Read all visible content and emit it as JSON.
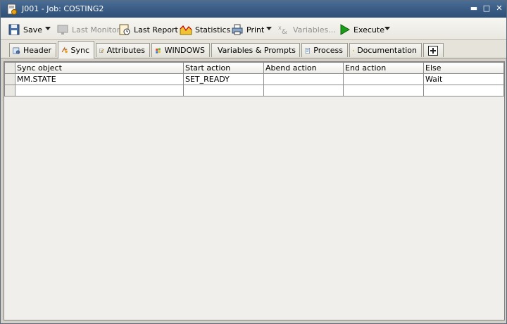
{
  "window": {
    "title": "J001 - Job: COSTING2"
  },
  "toolbar": {
    "save": "Save",
    "last_monitor": "Last Monitor",
    "last_report": "Last Report",
    "statistics": "Statistics",
    "print": "Print",
    "variables": "Variables...",
    "execute": "Execute"
  },
  "tabs": [
    {
      "label": "Header"
    },
    {
      "label": "Sync"
    },
    {
      "label": "Attributes"
    },
    {
      "label": "WINDOWS"
    },
    {
      "label": "Variables & Prompts"
    },
    {
      "label": "Process"
    },
    {
      "label": "Documentation"
    }
  ],
  "active_tab": "Sync",
  "grid": {
    "columns": [
      "Sync object",
      "Start action",
      "Abend action",
      "End action",
      "Else"
    ],
    "rows": [
      [
        "MM.STATE",
        "SET_READY",
        "",
        "",
        "Wait"
      ],
      [
        "",
        "",
        "",
        "",
        ""
      ]
    ]
  },
  "colors": {
    "titlebar": "#3b5d85",
    "execute_icon": "#1a9e1a"
  }
}
